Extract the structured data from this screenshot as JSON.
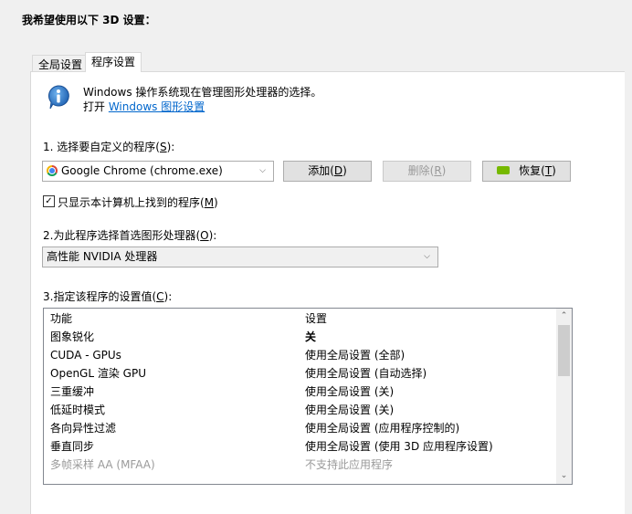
{
  "heading": "我希望使用以下 3D 设置：",
  "tabs": [
    {
      "label": "全局设置"
    },
    {
      "label": "程序设置"
    }
  ],
  "info": {
    "icon": "info-icon",
    "line1": "Windows 操作系统现在管理图形处理器的选择。",
    "line2_prefix": "打开 ",
    "link": "Windows 图形设置"
  },
  "step1": {
    "label_text": "1. 选择要自定义的程序(",
    "label_key": "S",
    "label_end": "):",
    "program": "Google Chrome (chrome.exe)",
    "add_text": "添加(",
    "add_key": "D",
    "remove_text": "删除(",
    "remove_key": "R",
    "restore_text": "恢复(",
    "restore_key": "T",
    "paren_close": ")",
    "checkbox_text": "只显示本计算机上找到的程序(",
    "checkbox_key": "M",
    "checkbox_checked": true
  },
  "step2": {
    "label_text": "2.为此程序选择首选图形处理器(",
    "label_key": "O",
    "label_end": "):",
    "value": "高性能 NVIDIA 处理器"
  },
  "step3": {
    "label_text": "3.指定该程序的设置值(",
    "label_key": "C",
    "label_end": "):",
    "columns": [
      "功能",
      "设置"
    ],
    "rows": [
      {
        "feature": "图象锐化",
        "setting": "关",
        "bold": true,
        "dim": false
      },
      {
        "feature": "CUDA - GPUs",
        "setting": "使用全局设置 (全部)",
        "bold": false,
        "dim": false
      },
      {
        "feature": "OpenGL 渲染 GPU",
        "setting": "使用全局设置 (自动选择)",
        "bold": false,
        "dim": false
      },
      {
        "feature": "三重缓冲",
        "setting": "使用全局设置 (关)",
        "bold": false,
        "dim": false
      },
      {
        "feature": "低延时模式",
        "setting": "使用全局设置 (关)",
        "bold": false,
        "dim": false
      },
      {
        "feature": "各向异性过滤",
        "setting": "使用全局设置 (应用程序控制的)",
        "bold": false,
        "dim": false
      },
      {
        "feature": "垂直同步",
        "setting": "使用全局设置 (使用 3D 应用程序设置)",
        "bold": false,
        "dim": false
      },
      {
        "feature": "多帧采样 AA (MFAA)",
        "setting": "不支持此应用程序",
        "bold": false,
        "dim": true
      }
    ]
  },
  "colors": {
    "link": "#0066cc",
    "nvidia": "#76b900"
  }
}
